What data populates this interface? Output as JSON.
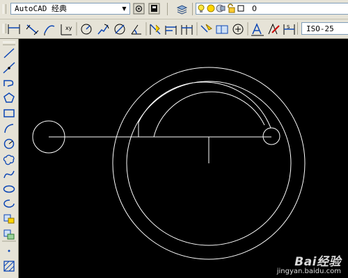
{
  "toolbar": {
    "workspace": {
      "value": "AutoCAD 经典"
    },
    "layer": {
      "current": "0"
    },
    "dimension": {
      "style_value": "ISO-25"
    }
  },
  "watermark": {
    "brand": "Bai经验",
    "url": "jingyan.baidu.com"
  },
  "colors": {
    "toolbar_bg": "#e6e3d7",
    "canvas_bg": "#000000",
    "geometry": "#ffffff",
    "icon_blue": "#0c46b4"
  }
}
